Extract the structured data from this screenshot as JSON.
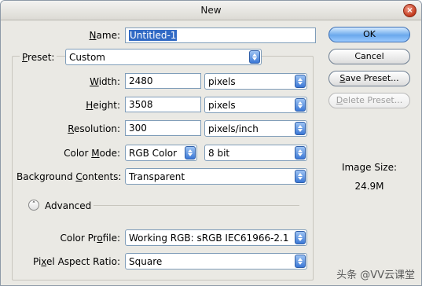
{
  "window": {
    "title": "New",
    "close_glyph": "×"
  },
  "name": {
    "label_mnemonic": "N",
    "label_rest": "ame:",
    "value": "Untitled-1"
  },
  "preset": {
    "label_mnemonic": "P",
    "label_rest": "reset:",
    "value": "Custom"
  },
  "width": {
    "label_mnemonic": "W",
    "label_rest": "idth:",
    "value": "2480",
    "unit": "pixels"
  },
  "height": {
    "label_mnemonic": "H",
    "label_rest": "eight:",
    "value": "3508",
    "unit": "pixels"
  },
  "resolution": {
    "label_mnemonic": "R",
    "label_rest": "esolution:",
    "value": "300",
    "unit": "pixels/inch"
  },
  "color_mode": {
    "label_pre": "Color ",
    "label_mnemonic": "M",
    "label_rest": "ode:",
    "value": "RGB Color",
    "bits": "8 bit"
  },
  "background": {
    "label_pre": "Background ",
    "label_mnemonic": "C",
    "label_rest": "ontents:",
    "value": "Transparent"
  },
  "advanced": {
    "label": "Advanced",
    "toggle_glyph": "˄"
  },
  "color_profile": {
    "label_pre": "Color Pr",
    "label_mnemonic": "o",
    "label_rest": "file:",
    "value": "Working RGB:  sRGB IEC61966-2.1"
  },
  "pixel_aspect": {
    "label_pre": "Pi",
    "label_mnemonic": "x",
    "label_rest": "el Aspect Ratio:",
    "value": "Square"
  },
  "buttons": {
    "ok": "OK",
    "cancel": "Cancel",
    "save_preset_mnemonic": "S",
    "save_preset_rest": "ave Preset...",
    "delete_preset_mnemonic": "D",
    "delete_preset_rest": "elete Preset..."
  },
  "image_size": {
    "label": "Image Size:",
    "value": "24.9M"
  },
  "watermark": "头条 @VV云课堂",
  "colors": {
    "dialog_bg": "#eae9e4",
    "selection_bg": "#316ac5",
    "primary_button": "#6aa8ec",
    "select_arrow": "#3b78d6"
  },
  "icons": [
    "close-icon",
    "select-arrow-icon",
    "collapse-chevron-icon"
  ]
}
